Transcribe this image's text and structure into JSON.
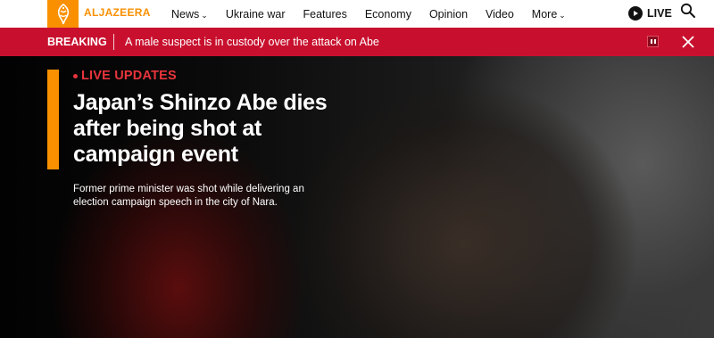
{
  "brand": {
    "logo_text": "ALJAZEERA",
    "accent_color": "#fa9000",
    "breaking_color": "#c8102e"
  },
  "nav": {
    "items": [
      {
        "label": "News",
        "has_dropdown": true
      },
      {
        "label": "Ukraine war",
        "has_dropdown": false
      },
      {
        "label": "Features",
        "has_dropdown": false
      },
      {
        "label": "Economy",
        "has_dropdown": false
      },
      {
        "label": "Opinion",
        "has_dropdown": false
      },
      {
        "label": "Video",
        "has_dropdown": false
      },
      {
        "label": "More",
        "has_dropdown": true
      }
    ],
    "live_label": "LIVE",
    "search_icon": "search-icon"
  },
  "breaking": {
    "label": "BREAKING",
    "text": "A male suspect is in custody over the attack on Abe",
    "pause_icon": "pause-icon",
    "close_icon": "close-icon"
  },
  "hero": {
    "kicker": "LIVE UPDATES",
    "headline": "Japan’s Shinzo Abe dies after being shot at campaign event",
    "summary": "Former prime minister was shot while delivering an election campaign speech in the city of Nara."
  }
}
